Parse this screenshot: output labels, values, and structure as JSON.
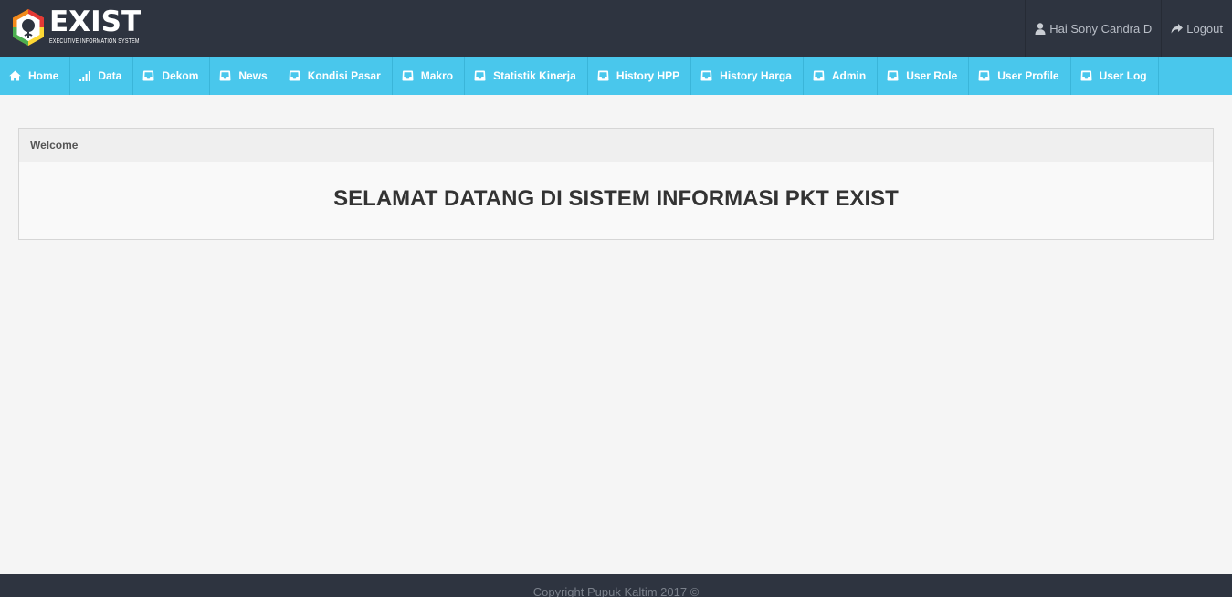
{
  "brand": {
    "title": "EXIST",
    "subtitle": "EXECUTIVE INFORMATION SYSTEM",
    "colors": {
      "orange": "#f28a1c",
      "green": "#4caf50",
      "red": "#e53935",
      "yellow": "#fdd835"
    }
  },
  "user": {
    "greeting": "Hai Sony Candra D",
    "logout_label": "Logout"
  },
  "nav": {
    "items": [
      {
        "label": "Home",
        "icon": "home-icon"
      },
      {
        "label": "Data",
        "icon": "signal-icon"
      },
      {
        "label": "Dekom",
        "icon": "inbox-icon"
      },
      {
        "label": "News",
        "icon": "inbox-icon"
      },
      {
        "label": "Kondisi Pasar",
        "icon": "inbox-icon"
      },
      {
        "label": "Makro",
        "icon": "inbox-icon"
      },
      {
        "label": "Statistik Kinerja",
        "icon": "inbox-icon"
      },
      {
        "label": "History HPP",
        "icon": "inbox-icon"
      },
      {
        "label": "History Harga",
        "icon": "inbox-icon"
      },
      {
        "label": "Admin",
        "icon": "inbox-icon"
      },
      {
        "label": "User Role",
        "icon": "inbox-icon"
      },
      {
        "label": "User Profile",
        "icon": "inbox-icon"
      },
      {
        "label": "User Log",
        "icon": "inbox-icon"
      }
    ]
  },
  "panel": {
    "heading": "Welcome",
    "message": "SELAMAT DATANG DI SISTEM INFORMASI PKT EXIST"
  },
  "footer": {
    "copyright": "Copyright Pupuk Kaltim 2017 ©"
  },
  "colors": {
    "topbar": "#2e3440",
    "nav": "#49c7ec",
    "background": "#f5f5f5"
  }
}
